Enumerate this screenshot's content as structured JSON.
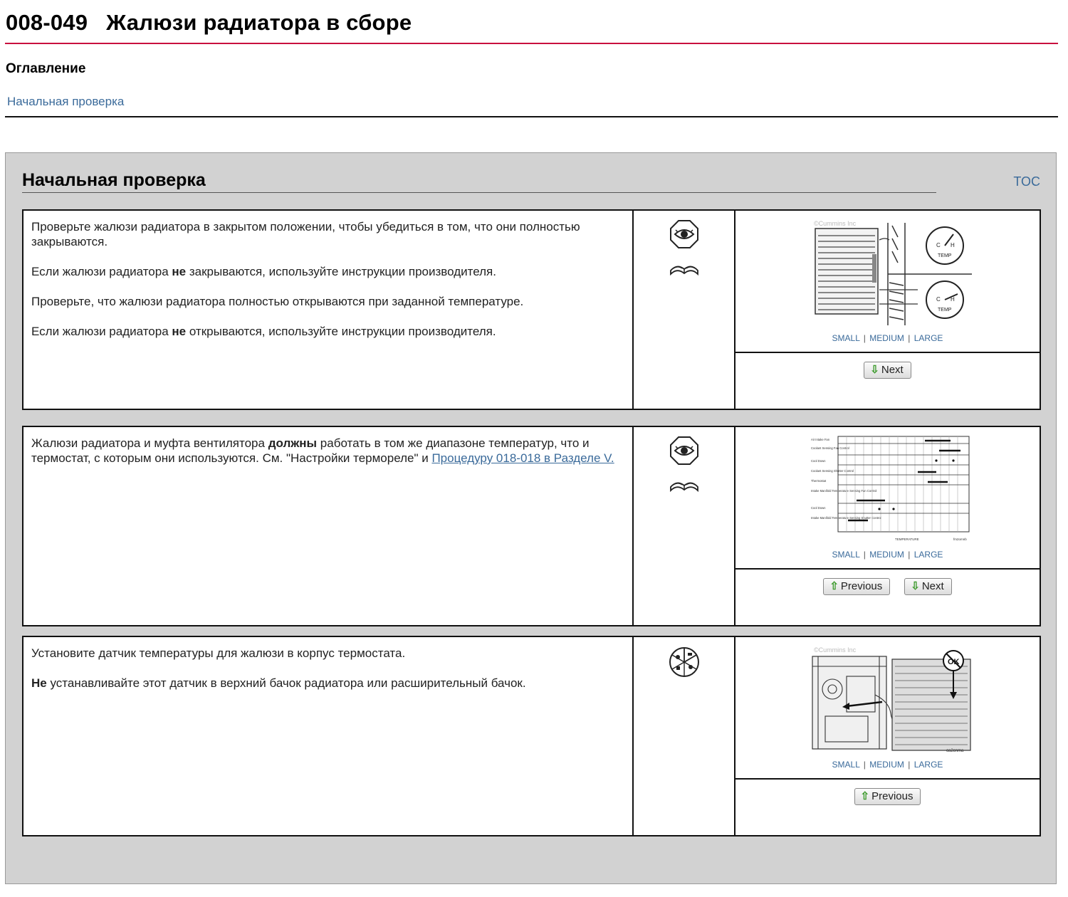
{
  "page": {
    "code": "008-049",
    "title": "Жалюзи радиатора в сборе"
  },
  "toc": {
    "heading": "Оглавление",
    "link": "Начальная проверка"
  },
  "section": {
    "title": "Начальная проверка",
    "toc_link": "TOC"
  },
  "size_links": {
    "small": "SMALL",
    "medium": "MEDIUM",
    "large": "LARGE",
    "sep": "|"
  },
  "buttons": {
    "previous": "Previous",
    "next": "Next"
  },
  "steps": [
    {
      "p1": "Проверьте жалюзи радиатора в закрытом положении, чтобы убедиться в том, что они полностью закрываются.",
      "p2_a": "Если жалюзи радиатора ",
      "p2_b": "не",
      "p2_c": " закрываются, используйте инструкции производителя.",
      "p3": "Проверьте, что жалюзи радиатора полностью открываются при заданной температуре.",
      "p4_a": "Если жалюзи радиатора ",
      "p4_b": "не",
      "p4_c": " открываются, используйте инструкции производителя.",
      "icons": [
        "eye-icon",
        "manual-icon"
      ],
      "image_label": "©Cummins Inc",
      "gauge_label": "TEMP",
      "gauge_c": "C",
      "gauge_h": "H"
    },
    {
      "p1_a": "Жалюзи радиатора и муфта вентилятора ",
      "p1_b": "должны",
      "p1_c": " работать в том же диапазоне температур, что и термостат, с которым они используются. См. \"Настройки термореле\" и ",
      "p1_link": "Процедуру 018-018 в Разделе V.",
      "icons": [
        "eye-icon",
        "manual-icon"
      ],
      "chart_axis_label": "TEMPERATURE",
      "chart_code": "fm2omnb",
      "chart_row_labels": [
        "Air Intake Fan",
        "Coolant Sensing Fan Control",
        "Cool Down",
        "Coolant Sensing Shutter Control",
        "Thermostat",
        "Intake Manifold Temperature Sensing Fan Control",
        "Cool Down",
        "Intake Manifold Temperature Sensing Shutter Control"
      ]
    },
    {
      "p1": "Установите датчик температуры для жалюзи в корпус термостата.",
      "p2_a": "Не",
      "p2_b": " устанавливайте этот датчик в верхний бачок радиатора или расширительный бачок.",
      "icons": [
        "tools-icon"
      ],
      "image_label": "©Cummins Inc",
      "ok_label": "OK",
      "image_code": "ca2cnma"
    }
  ]
}
